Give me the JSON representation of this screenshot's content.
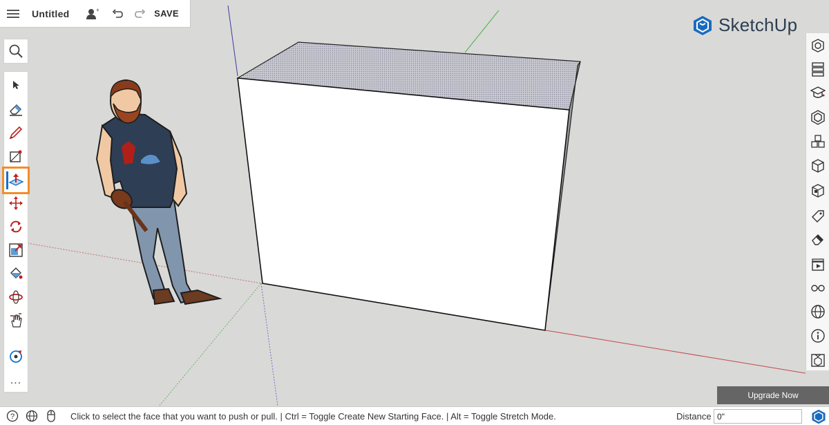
{
  "header": {
    "menu_icon": "hamburger-menu-icon",
    "document_title": "Untitled",
    "share_icon": "add-user-icon",
    "undo_icon": "undo-icon",
    "redo_icon": "redo-icon",
    "save_label": "SAVE"
  },
  "logo": {
    "text": "SketchUp",
    "icon": "sketchup-logo-icon",
    "color": "#2c3e50"
  },
  "tools": {
    "search_icon": "search-icon",
    "items": [
      {
        "name": "select",
        "icon": "select-arrow-icon"
      },
      {
        "name": "eraser",
        "icon": "eraser-icon"
      },
      {
        "name": "pencil",
        "icon": "pencil-icon"
      },
      {
        "name": "rectangle",
        "icon": "rectangle-icon"
      },
      {
        "name": "push-pull",
        "icon": "push-pull-icon",
        "active": true
      },
      {
        "name": "move",
        "icon": "move-icon"
      },
      {
        "name": "rotate",
        "icon": "rotate-icon"
      },
      {
        "name": "scale",
        "icon": "scale-icon"
      },
      {
        "name": "paint",
        "icon": "paint-bucket-icon"
      },
      {
        "name": "orbit",
        "icon": "orbit-icon"
      },
      {
        "name": "pan",
        "icon": "pan-hand-icon"
      },
      {
        "name": "zoom-extents",
        "icon": "zoom-extents-icon"
      }
    ],
    "more_label": "...",
    "active_color": "#f28c28"
  },
  "right_panel": {
    "items": [
      {
        "name": "entity-info",
        "icon": "entity-info-icon"
      },
      {
        "name": "outliner",
        "icon": "outliner-icon"
      },
      {
        "name": "instructor",
        "icon": "instructor-icon"
      },
      {
        "name": "components",
        "icon": "components-icon"
      },
      {
        "name": "materials",
        "icon": "materials-icon"
      },
      {
        "name": "styles",
        "icon": "styles-icon"
      },
      {
        "name": "solid-tools",
        "icon": "solid-tools-icon"
      },
      {
        "name": "tags",
        "icon": "tag-icon"
      },
      {
        "name": "erase-tool",
        "icon": "erase-panel-icon"
      },
      {
        "name": "scenes",
        "icon": "scenes-icon"
      },
      {
        "name": "display",
        "icon": "glasses-icon"
      },
      {
        "name": "geo-location",
        "icon": "globe-icon"
      },
      {
        "name": "model-info",
        "icon": "info-icon"
      },
      {
        "name": "3d-warehouse",
        "icon": "warehouse-icon"
      }
    ]
  },
  "upgrade_label": "Upgrade Now",
  "statusbar": {
    "help_icon": "help-icon",
    "globe_icon": "globe-icon",
    "mouse_icon": "mouse-icon",
    "message": "Click to select the face that you want to push or pull. | Ctrl = Toggle Create New Starting Face. | Alt = Toggle Stretch Mode.",
    "distance_label": "Distance",
    "distance_value": "0\""
  },
  "colors": {
    "background": "#d9d9d7",
    "accent_blue": "#1570c9",
    "axis_red": "#c04848",
    "axis_green": "#4fb24f",
    "axis_blue": "#3c3ca0"
  }
}
